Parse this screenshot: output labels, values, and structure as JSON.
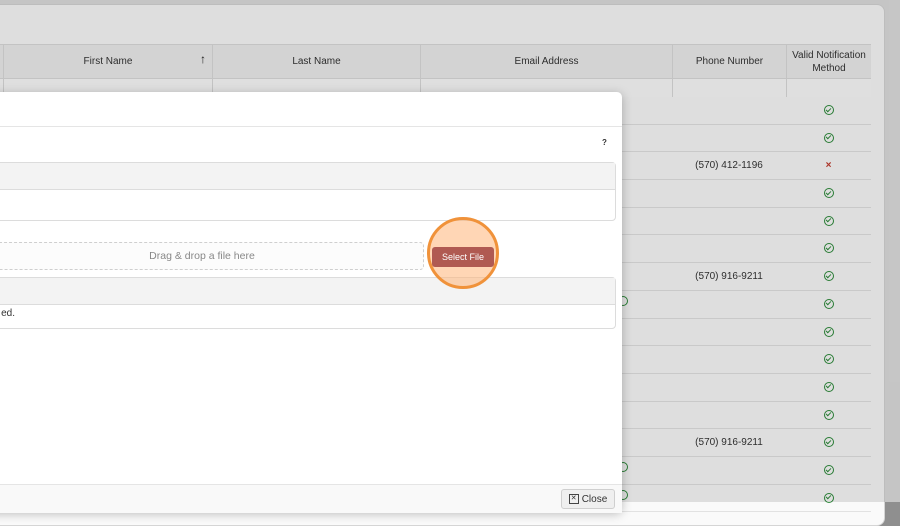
{
  "grid": {
    "columns": [
      {
        "key": "first_name",
        "label": "First Name",
        "sorted": "asc"
      },
      {
        "key": "last_name",
        "label": "Last Name"
      },
      {
        "key": "email",
        "label": "Email Address"
      },
      {
        "key": "phone",
        "label": "Phone Number"
      },
      {
        "key": "notification",
        "label": "Valid Notification Method"
      }
    ],
    "sort_icon": "arrow-up-icon",
    "rows": [
      {
        "phone": "",
        "notification": "valid"
      },
      {
        "phone": "",
        "notification": "valid"
      },
      {
        "phone": "(570) 412-1196",
        "notification": "invalid"
      },
      {
        "phone": "",
        "notification": "valid"
      },
      {
        "phone": "",
        "notification": "valid"
      },
      {
        "phone": "",
        "notification": "valid"
      },
      {
        "phone": "(570) 916-9211",
        "notification": "valid"
      },
      {
        "phone": "",
        "notification": "valid",
        "email_icon": true
      },
      {
        "phone": "",
        "notification": "valid"
      },
      {
        "phone": "",
        "notification": "valid"
      },
      {
        "phone": "",
        "notification": "valid"
      },
      {
        "phone": "",
        "notification": "valid"
      },
      {
        "phone": "(570) 916-9211",
        "notification": "valid"
      },
      {
        "phone": "",
        "notification": "valid",
        "email_icon": true
      },
      {
        "phone": "",
        "notification": "valid",
        "email_icon": true
      }
    ]
  },
  "modal": {
    "help_label": "?",
    "dropzone_text": "Drag & drop a file here",
    "select_file_label": "Select File",
    "result_text_fragment": "ed.",
    "close_label": "Close"
  },
  "colors": {
    "select_button": "#b05a52",
    "highlight_ring": "#f0923a",
    "valid_icon": "#2e8b3b",
    "invalid_icon": "#c0392b"
  }
}
